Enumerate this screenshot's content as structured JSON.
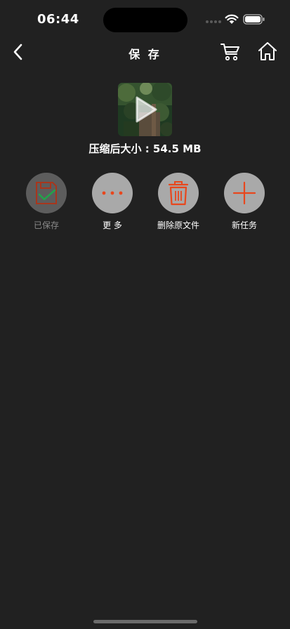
{
  "status_bar": {
    "time": "06:44"
  },
  "nav": {
    "title": "保 存"
  },
  "preview": {
    "size_label": "压缩后大小 : 54.5 MB"
  },
  "actions": [
    {
      "label": "已保存",
      "icon": "save-check-icon",
      "state": "done"
    },
    {
      "label": "更 多",
      "icon": "more-dots-icon"
    },
    {
      "label": "删除原文件",
      "icon": "trash-icon"
    },
    {
      "label": "新任务",
      "icon": "plus-icon"
    }
  ],
  "colors": {
    "background": "#212121",
    "accent": "#e8471d",
    "button": "#a9a9a9",
    "button_done": "#5d5d5d"
  }
}
